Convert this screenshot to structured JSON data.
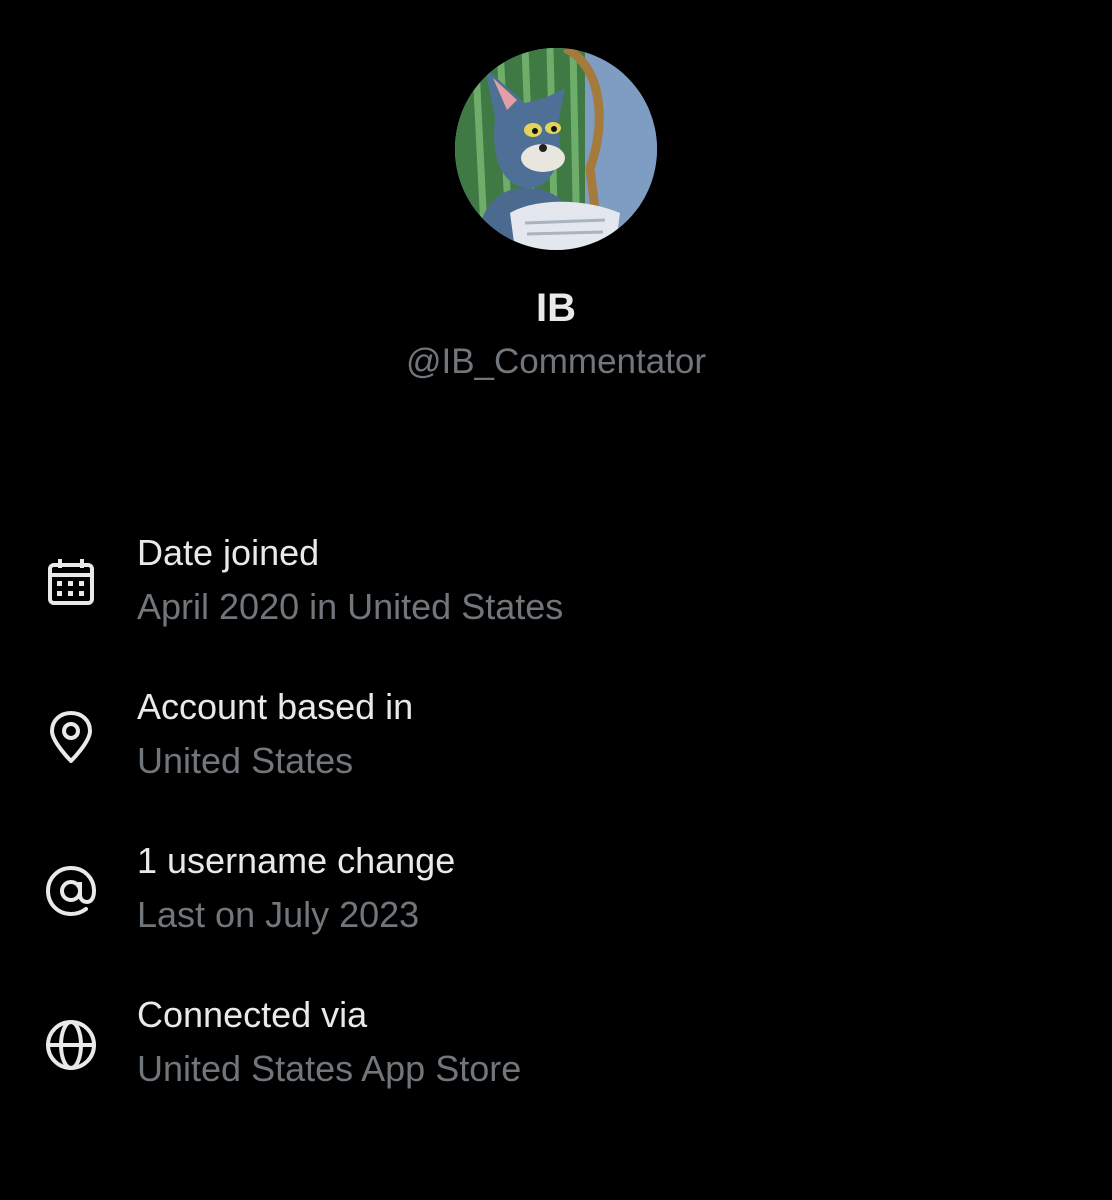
{
  "profile": {
    "display_name": "IB",
    "handle": "@IB_Commentator",
    "avatar_icon": "cartoon-cat-avatar"
  },
  "about": {
    "items": [
      {
        "icon": "calendar-icon",
        "title": "Date joined",
        "value": "April 2020 in United States"
      },
      {
        "icon": "location-pin-icon",
        "title": "Account based in",
        "value": "United States"
      },
      {
        "icon": "at-sign-icon",
        "title": "1 username change",
        "value": "Last on July 2023"
      },
      {
        "icon": "globe-icon",
        "title": "Connected via",
        "value": "United States App Store"
      }
    ]
  },
  "colors": {
    "background": "#000000",
    "primary_text": "#e7e9ea",
    "secondary_text": "#71767b"
  }
}
